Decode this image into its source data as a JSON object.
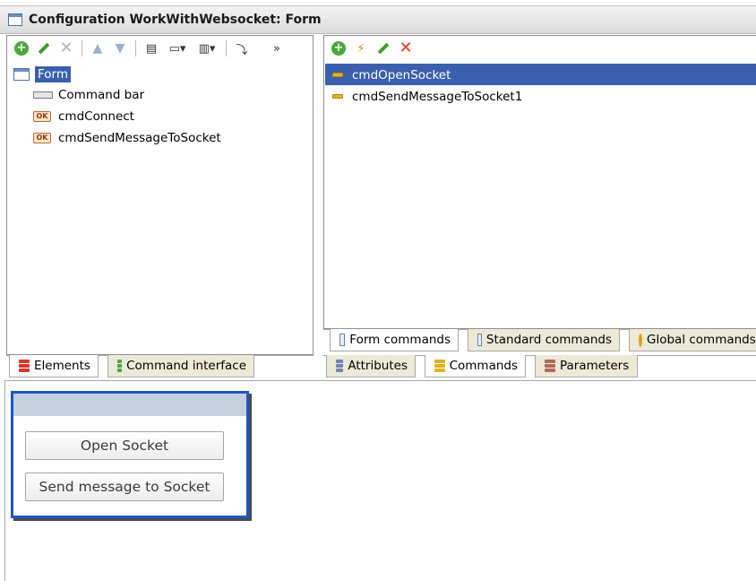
{
  "window": {
    "title": "Configuration WorkWithWebsocket: Form"
  },
  "left_pane": {
    "toolbar": [
      "add-icon",
      "edit-icon",
      "delete-icon",
      "move-up-icon",
      "move-down-icon",
      "form-icon",
      "display-icon",
      "layout-icon",
      "link-icon",
      "more-icon"
    ],
    "tree": {
      "root": "Form",
      "items": [
        "Command bar",
        "cmdConnect",
        "cmdSendMessageToSocket"
      ]
    },
    "tabs": [
      "Elements",
      "Command interface"
    ]
  },
  "right_pane": {
    "toolbar": [
      "add-icon",
      "add-item-icon",
      "edit-icon",
      "delete-icon"
    ],
    "commands": [
      "cmdOpenSocket",
      "cmdSendMessageToSocket1"
    ],
    "inner_tabs": [
      "Form commands",
      "Standard commands",
      "Global commands"
    ],
    "tabs": [
      "Attributes",
      "Commands",
      "Parameters"
    ]
  },
  "preview": {
    "buttons": [
      "Open Socket",
      "Send message to Socket"
    ]
  },
  "colors": {
    "selection": "#3a5fad",
    "preview_border": "#1e56c8"
  }
}
